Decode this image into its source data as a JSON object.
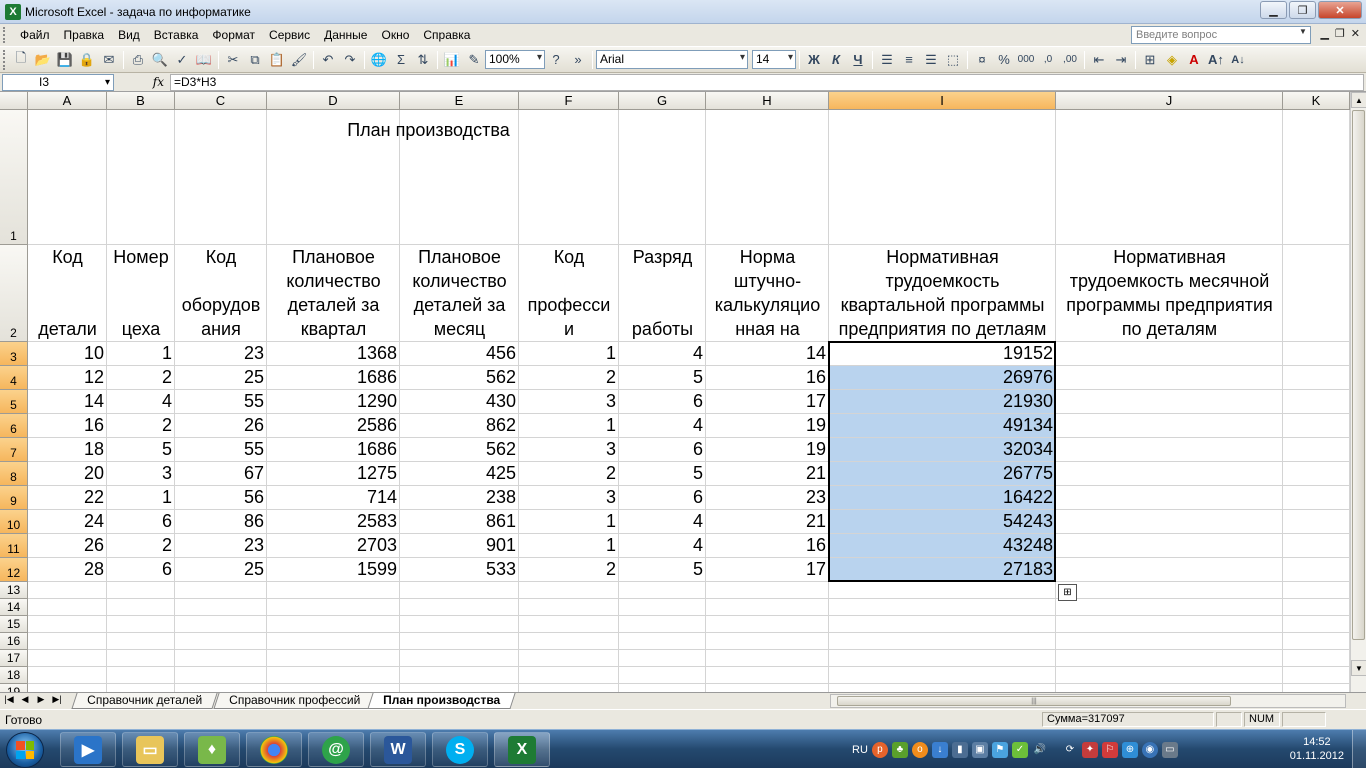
{
  "window": {
    "title": "Microsoft Excel - задача по информатике",
    "app_icon": "X"
  },
  "menu": [
    "Файл",
    "Правка",
    "Вид",
    "Вставка",
    "Формат",
    "Сервис",
    "Данные",
    "Окно",
    "Справка"
  ],
  "help": {
    "placeholder": "Введите вопрос"
  },
  "toolbar": {
    "zoom": "100%",
    "font": "Arial",
    "size": "14",
    "bold": "Ж",
    "italic": "К",
    "underline": "Ч",
    "percent": "%",
    "thousands": "000",
    "dec_inc": ",0",
    "dec_dec": ",00"
  },
  "formula_bar": {
    "name_box": "I3",
    "fx": "fx",
    "formula": "=D3*H3"
  },
  "columns": [
    "A",
    "B",
    "C",
    "D",
    "E",
    "F",
    "G",
    "H",
    "I",
    "J",
    "K"
  ],
  "sheet": {
    "title": "План производства",
    "headers": [
      [
        "Код",
        "",
        "",
        "детали"
      ],
      [
        "Номер",
        "",
        "",
        "цеха"
      ],
      [
        "Код",
        "",
        "оборудов",
        "ания"
      ],
      [
        "Плановое",
        "количество",
        "деталей за",
        "квартал"
      ],
      [
        "Плановое",
        "количество",
        "деталей за",
        "месяц"
      ],
      [
        "Код",
        "",
        "професси",
        "и"
      ],
      [
        "Разряд",
        "",
        "",
        "работы"
      ],
      [
        "Норма",
        "штучно-",
        "калькуляцио",
        "нная на"
      ],
      [
        "Нормативная",
        "трудоемкость",
        "квартальной программы",
        "предприятия по детлаям"
      ],
      [
        "Нормативная",
        "трудоемкость месячной",
        "программы предприятия",
        "по деталям"
      ]
    ],
    "rows": [
      [
        10,
        1,
        23,
        1368,
        456,
        1,
        4,
        14,
        19152
      ],
      [
        12,
        2,
        25,
        1686,
        562,
        2,
        5,
        16,
        26976
      ],
      [
        14,
        4,
        55,
        1290,
        430,
        3,
        6,
        17,
        21930
      ],
      [
        16,
        2,
        26,
        2586,
        862,
        1,
        4,
        19,
        49134
      ],
      [
        18,
        5,
        55,
        1686,
        562,
        3,
        6,
        19,
        32034
      ],
      [
        20,
        3,
        67,
        1275,
        425,
        2,
        5,
        21,
        26775
      ],
      [
        22,
        1,
        56,
        714,
        238,
        3,
        6,
        23,
        16422
      ],
      [
        24,
        6,
        86,
        2583,
        861,
        1,
        4,
        21,
        54243
      ],
      [
        26,
        2,
        23,
        2703,
        901,
        1,
        4,
        16,
        43248
      ],
      [
        28,
        6,
        25,
        1599,
        533,
        2,
        5,
        17,
        27183
      ]
    ]
  },
  "tabs": [
    "Справочник деталей",
    "Справочник профессий",
    "План производства"
  ],
  "active_tab": "План производства",
  "status": {
    "ready": "Готово",
    "sum": "Сумма=317097",
    "num": "NUM"
  },
  "taskbar": {
    "lang": "RU",
    "time": "14:52",
    "date": "01.11.2012"
  }
}
